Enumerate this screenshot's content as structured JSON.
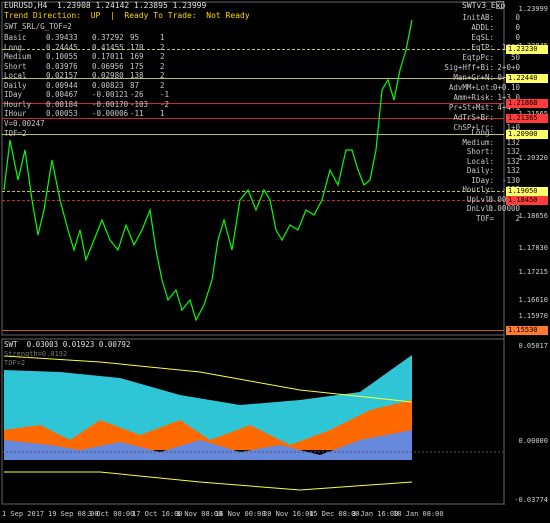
{
  "header": {
    "symbol_line": "EURUSD,H4  1.23908 1.24142 1.23895 1.23999",
    "trend_line": "Trend Direction:  UP  |  Ready To Trade:  Not Ready",
    "indicator_title": "SWTv3_Exp"
  },
  "left_stats": {
    "title": "SWT_SRL/G_TOF=2",
    "rows": [
      [
        "Basic",
        "0.39433",
        "0.37292",
        "95",
        "1"
      ],
      [
        "Long",
        "0.24445",
        "0.41455",
        "170",
        "2"
      ],
      [
        "Medium",
        "0.10055",
        "0.17011",
        "169",
        "2"
      ],
      [
        "Short",
        "0.03976",
        "0.06956",
        "175",
        "2"
      ],
      [
        "Local",
        "0.02157",
        "0.02980",
        "138",
        "2"
      ],
      [
        "Daily",
        "0.00944",
        "0.00823",
        "87",
        "2"
      ],
      [
        "IDay",
        "0.00467",
        "-0.00121",
        "-26",
        "-1"
      ],
      [
        "Hourly",
        "0.00184",
        "-0.00170",
        "-103",
        "-2"
      ],
      [
        "IHour",
        "0.00053",
        "-0.00006",
        "-11",
        "1"
      ]
    ],
    "footer1": "V=0.00247",
    "footer2": "TOF=2"
  },
  "right_stats_top": [
    [
      "InitAB:",
      "0"
    ],
    [
      "ADDL:",
      "0"
    ],
    [
      "EqSL:",
      "0"
    ],
    [
      "EqTP:",
      "1800"
    ],
    [
      "EqtpPc:",
      "50"
    ],
    [
      "Sig+Hff+Bi:",
      "2+0+0"
    ],
    [
      "Man+Gr+N:",
      "0+1+2"
    ],
    [
      "AdvMM+Lot:",
      "0+0.10"
    ],
    [
      "Amm+Risk:",
      "1+3.0"
    ],
    [
      "Pr+St+Mst:",
      "4+4+1"
    ],
    [
      "AdTrS+Br:",
      "1+0"
    ],
    [
      "ChSP+Lrc:",
      "1+0"
    ]
  ],
  "right_stats_bottom": [
    [
      "Long:",
      "132"
    ],
    [
      "Medium:",
      "132"
    ],
    [
      "Short:",
      "132"
    ],
    [
      "Local:",
      "132"
    ],
    [
      "Daily:",
      "132"
    ],
    [
      "IDay:",
      "-130"
    ],
    [
      "Hourly:",
      "-132"
    ],
    [
      "UpLvl:",
      "0.00000"
    ],
    [
      "DnLvl:",
      "0.00000"
    ],
    [
      "TOF=",
      "2"
    ]
  ],
  "price_axis": [
    "1.23999",
    "1.22845",
    "1.22440",
    "1.21565",
    "1.20320",
    "1.19059",
    "1.18656",
    "1.17830",
    "1.17215",
    "1.16610",
    "1.15970",
    "1.15330"
  ],
  "price_tags": [
    {
      "label": "1.23230",
      "color": "#ffff66"
    },
    {
      "label": "1.22440",
      "color": "#ffff66"
    },
    {
      "label": "1.21868",
      "color": "#ff3b3b"
    },
    {
      "label": "1.21365",
      "color": "#ff3b3b"
    },
    {
      "label": "1.20900",
      "color": "#ffff66"
    },
    {
      "label": "1.19050",
      "color": "#ffff66"
    },
    {
      "label": "1.18450",
      "color": "#ff3b3b"
    },
    {
      "label": "1.15530",
      "color": "#ff7a2e"
    }
  ],
  "sub_window": {
    "title_line": "SWT  0.03003 0.01923 0.00792",
    "faint_line1": "Strength=0.0192",
    "faint_line2": "TOF=2",
    "axis": [
      "0.05017",
      "0.00000",
      "-0.03774"
    ]
  },
  "time_axis": [
    "1 Sep 2017",
    "19 Sep 08:00",
    "3 Oct 00:00",
    "17 Oct 16:00",
    "1 Nov 08:00",
    "16 Nov 00:00",
    "30 Nov 16:00",
    "15 Dec 08:00",
    "3 Jan 16:00",
    "18 Jan 08:00"
  ],
  "colors": {
    "price_line": "#00ff00",
    "cyan_area": "#2ec6d6",
    "orange_area": "#ff6a00",
    "blue_area": "#6688dd",
    "yellow_line": "#ffff33",
    "red_line": "#ff2a2a"
  }
}
